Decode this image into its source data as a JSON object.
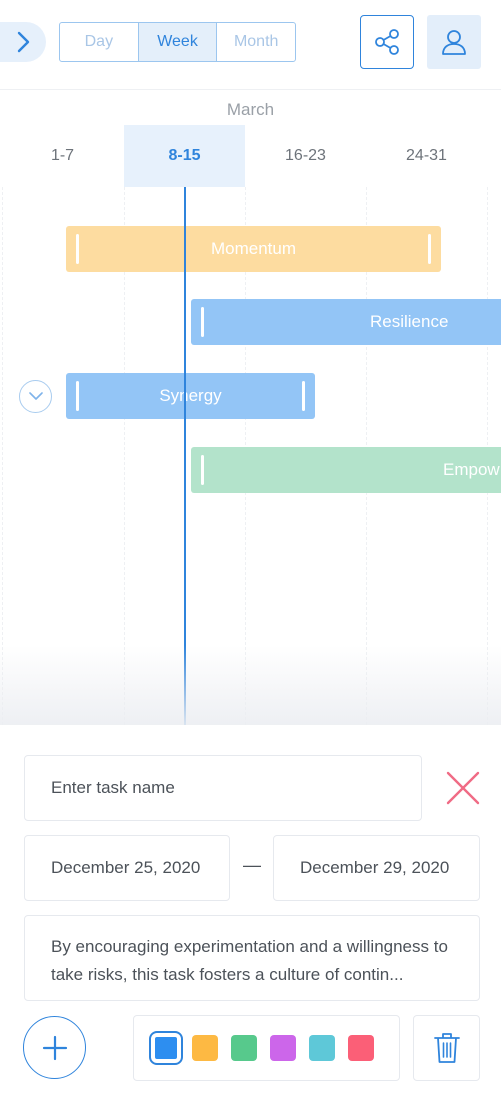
{
  "header": {
    "view_modes": [
      {
        "label": "Day",
        "active": false
      },
      {
        "label": "Week",
        "active": true
      },
      {
        "label": "Month",
        "active": false
      }
    ],
    "share_icon": "share-icon",
    "user_icon": "user-icon",
    "expand_icon": "chevron-right-icon"
  },
  "timeline": {
    "month": "March",
    "weeks": [
      "1-7",
      "8-15",
      "16-23",
      "24-31"
    ],
    "active_week": "8-15",
    "tasks": [
      {
        "name": "Momentum",
        "color": "#fddca0"
      },
      {
        "name": "Resilience",
        "color": "#93c5f6"
      },
      {
        "name": "Synergy",
        "color": "#93c5f6"
      },
      {
        "name": "Empow",
        "color": "#b3e3cb"
      }
    ]
  },
  "editor": {
    "task_name_placeholder": "Enter task name",
    "start_date": "December 25, 2020",
    "date_separator": "—",
    "end_date": "December 29, 2020",
    "description": "By encouraging experimentation and a willingness to take risks, this task fosters a culture of contin...",
    "colors": [
      {
        "hex": "#2d8ef0",
        "selected": true
      },
      {
        "hex": "#fdb943",
        "selected": false
      },
      {
        "hex": "#57c98c",
        "selected": false
      },
      {
        "hex": "#cc66ea",
        "selected": false
      },
      {
        "hex": "#5ec8d8",
        "selected": false
      },
      {
        "hex": "#fb5f77",
        "selected": false
      }
    ],
    "accent_color": "#2f84dc",
    "close_color": "#f06b85"
  }
}
